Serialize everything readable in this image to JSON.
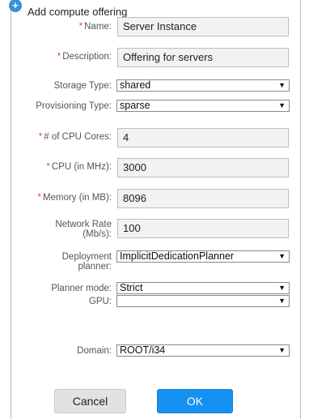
{
  "header": {
    "title": "Add compute offering",
    "icon": "plus-circle-icon"
  },
  "required_marker": "*",
  "fields": {
    "name": {
      "label": "Name:",
      "value": "Server Instance"
    },
    "description": {
      "label": "Description:",
      "value": "Offering for servers"
    },
    "storage_type": {
      "label": "Storage Type:",
      "value": "shared"
    },
    "provisioning_type": {
      "label": "Provisioning Type:",
      "value": "sparse"
    },
    "cpu_cores": {
      "label": "# of CPU Cores:",
      "value": "4"
    },
    "cpu_mhz": {
      "label": "CPU (in MHz):",
      "value": "3000"
    },
    "memory_mb": {
      "label": "Memory (in MB):",
      "value": "8096"
    },
    "network_rate": {
      "label_line1": "Network Rate",
      "label_line2": "(Mb/s):",
      "value": "100"
    },
    "deployment_planner": {
      "label_line1": "Deployment",
      "label_line2": "planner:",
      "value": "ImplicitDedicationPlanner"
    },
    "planner_mode": {
      "label": "Planner mode:",
      "value": "Strict"
    },
    "gpu": {
      "label": "GPU:",
      "value": ""
    },
    "domain": {
      "label": "Domain:",
      "value": "ROOT/i34"
    }
  },
  "buttons": {
    "cancel": "Cancel",
    "ok": "OK"
  },
  "dropdown_arrow": "▼",
  "colors": {
    "required": "#e04a3d",
    "ok_button": "#1591f2",
    "header_icon": "#3a8fd6"
  }
}
